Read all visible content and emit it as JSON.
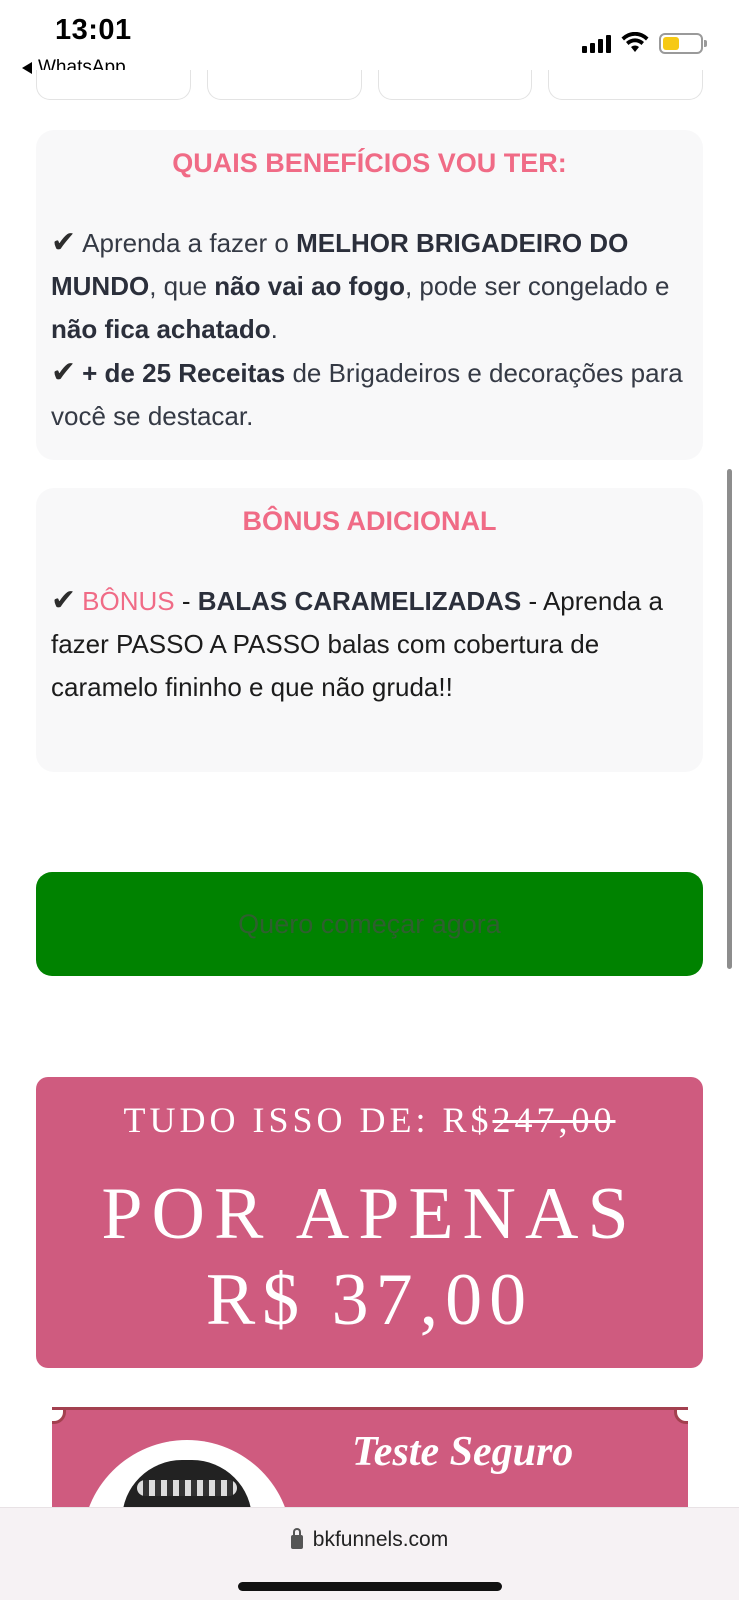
{
  "status_bar": {
    "time": "13:01",
    "back_label": "WhatsApp",
    "battery_level": 0.45
  },
  "benefits": {
    "title": "QUAIS BENEFÍCIOS VOU TER:",
    "line1_a": "Aprenda a fazer o ",
    "line1_b": "MELHOR BRIGADEIRO DO MUNDO",
    "line1_c": ", que ",
    "line1_d": "não vai ao fogo",
    "line1_e": ", pode ser congelado e ",
    "line1_f": "não fica achatado",
    "line1_g": ".",
    "line2_a": "+ de 25 Receitas",
    "line2_b": " de Brigadeiros e decorações para você se destacar."
  },
  "bonus": {
    "title": "BÔNUS ADICIONAL",
    "tag": "BÔNUS",
    "sep1": " - ",
    "name": "BALAS CARAMELIZADAS",
    "sep2": " - ",
    "desc": "Aprenda a fazer PASSO A PASSO balas com cobertura de caramelo fininho e que não gruda!!"
  },
  "cta": {
    "label": "Quero começar agora"
  },
  "price": {
    "prefix": "TUDO ISSO DE: R$",
    "old_value": "247,00",
    "line2": "POR APENAS",
    "line3": "R$ 37,00"
  },
  "guarantee": {
    "title": "Teste Seguro"
  },
  "browser": {
    "url": "bkfunnels.com"
  },
  "colors": {
    "accent_pink": "#f06b86",
    "cta_green": "#008200",
    "price_bg": "#cf5b7f"
  }
}
